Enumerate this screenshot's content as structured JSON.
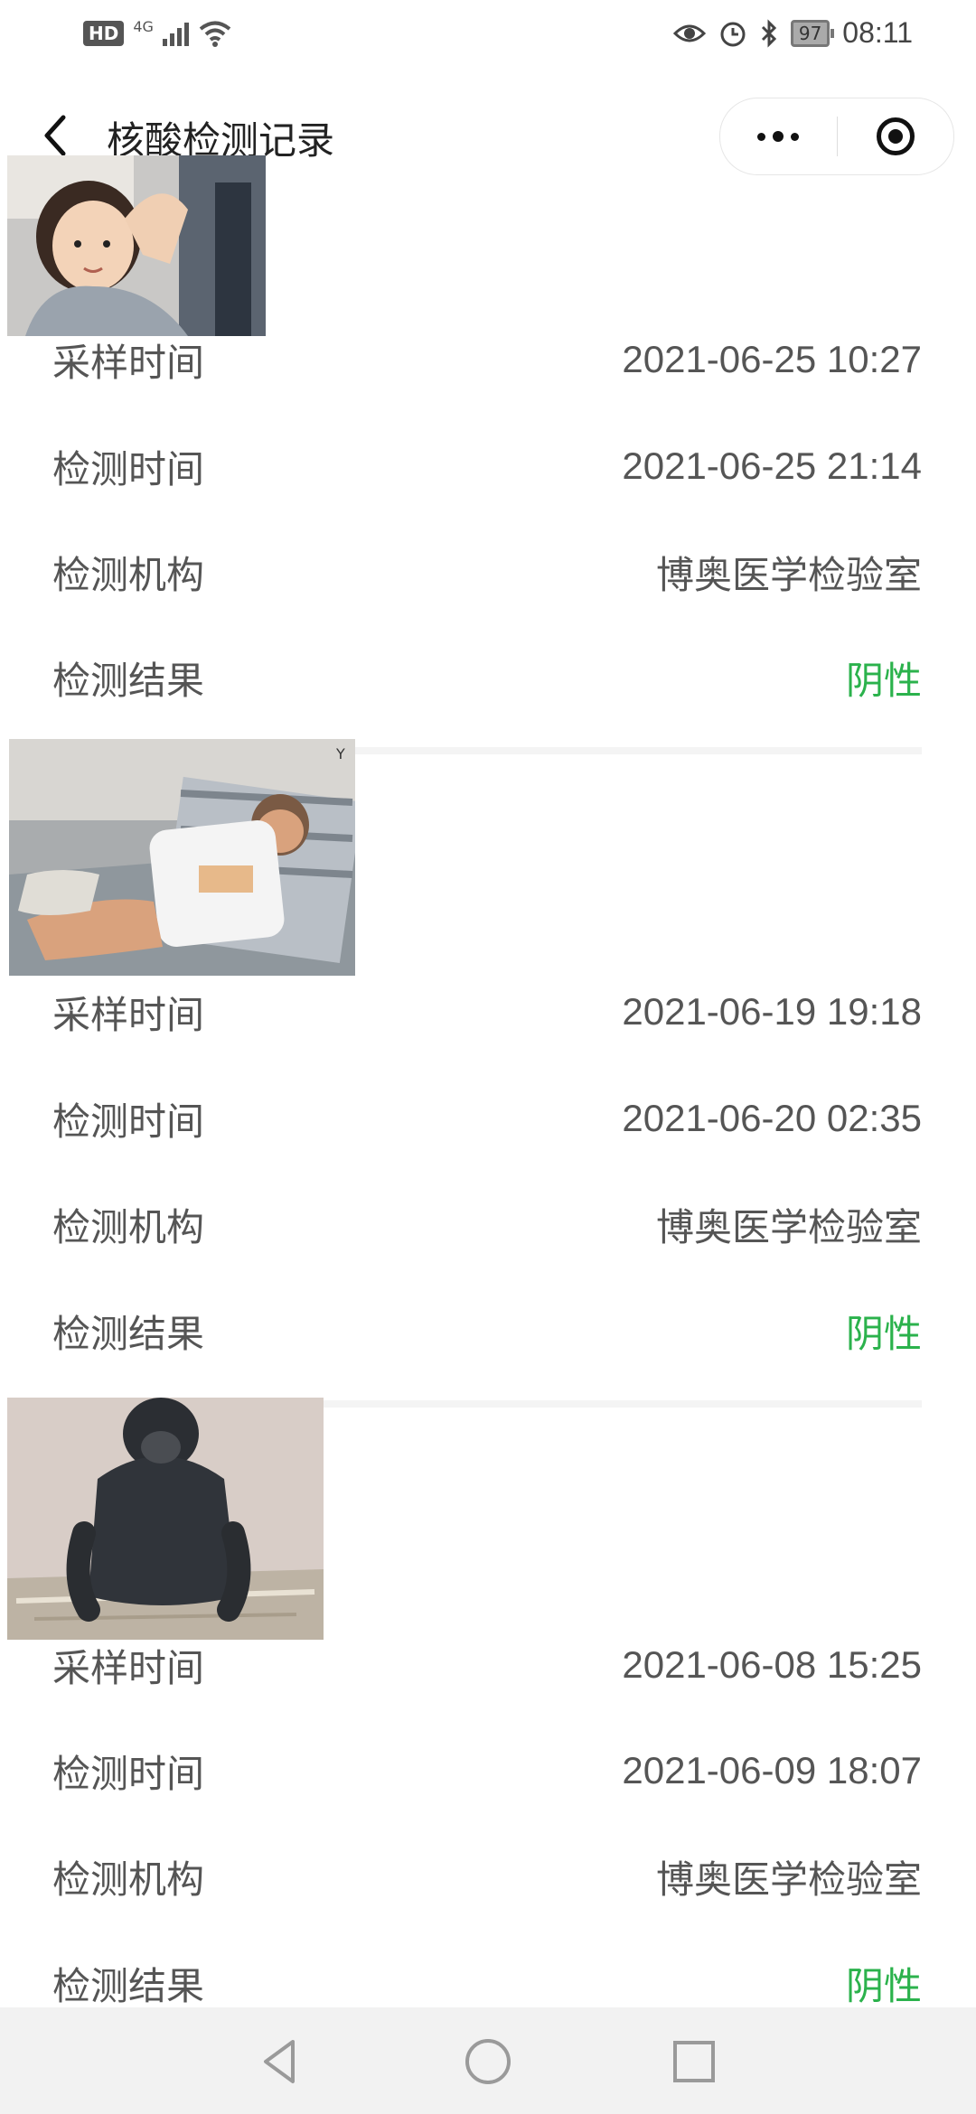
{
  "status_bar": {
    "hd_badge": "HD",
    "network": "4G",
    "battery": "97",
    "time": "08:11"
  },
  "header": {
    "title": "核酸检测记录"
  },
  "records": [
    {
      "sample_label": "采样时间",
      "sample_time": "2021-06-25 10:27",
      "test_label": "检测时间",
      "test_time": "2021-06-25 21:14",
      "org_label": "检测机构",
      "org": "博奥医学检验室",
      "result_label": "检测结果",
      "result": "阴性"
    },
    {
      "sample_label": "采样时间",
      "sample_time": "2021-06-19 19:18",
      "test_label": "检测时间",
      "test_time": "2021-06-20 02:35",
      "org_label": "检测机构",
      "org": "博奥医学检验室",
      "result_label": "检测结果",
      "result": "阴性"
    },
    {
      "sample_label": "采样时间",
      "sample_time": "2021-06-08 15:25",
      "test_label": "检测时间",
      "test_time": "2021-06-09 18:07",
      "org_label": "检测机构",
      "org": "博奥医学检验室",
      "result_label": "检测结果",
      "result": "阴性"
    }
  ],
  "colors": {
    "result_negative": "#2bb24c"
  }
}
